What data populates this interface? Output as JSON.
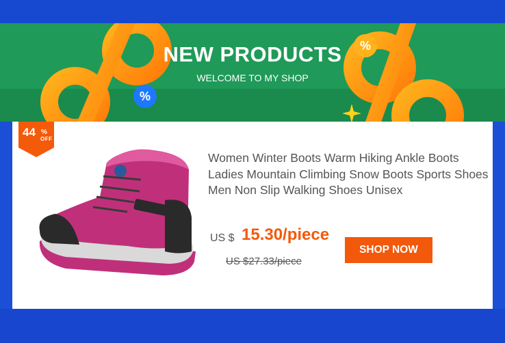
{
  "banner": {
    "title": "NEW PRODUCTS",
    "subtitle": "WELCOME TO MY SHOP",
    "percent_symbol": "%"
  },
  "discount": {
    "value": "44",
    "percent": "%",
    "off": "OFF"
  },
  "product": {
    "title": "Women Winter Boots Warm Hiking Ankle Boots Ladies Mountain Climbing Snow Boots Sports Shoes Men Non Slip Walking Shoes Unisex",
    "price_label": "US $",
    "price": "15.30/piece",
    "old_price": "US $27.33/piece",
    "image_icon": "hiking-boot-image"
  },
  "cta": {
    "label": "SHOP NOW"
  },
  "colors": {
    "background_blue": "#1a4fd6",
    "banner_green": "#1f9a58",
    "accent_orange": "#f35a0a",
    "percent_badge_blue": "#1e78ff",
    "boot_pink": "#c0307a"
  }
}
